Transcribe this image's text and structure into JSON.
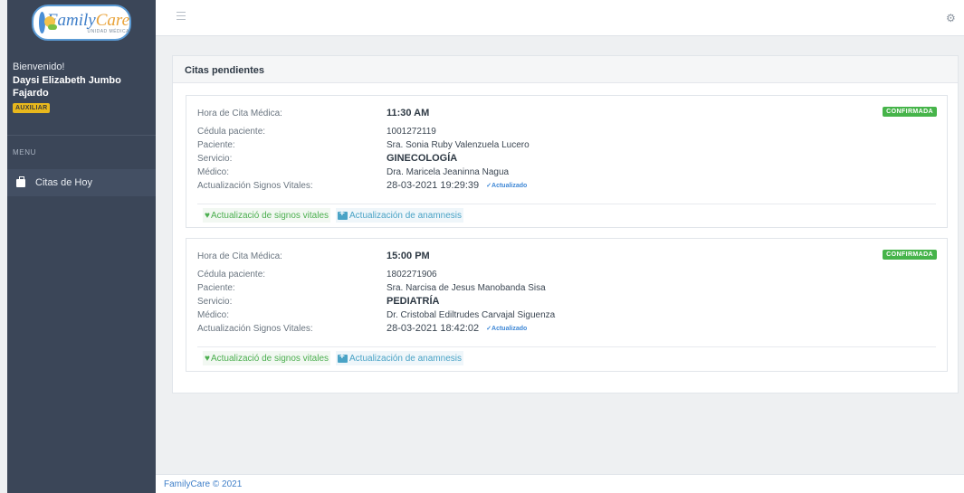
{
  "app": {
    "logo_word_1": "Family",
    "logo_word_2": "Care",
    "logo_sub": "UNIDAD MÉDICA"
  },
  "sidebar": {
    "welcome": "Bienvenido!",
    "user_name": "Daysi Elizabeth Jumbo Fajardo",
    "role": "AUXILIAR",
    "menu_title": "MENU",
    "items": [
      {
        "label": "Citas de Hoy",
        "icon": "briefcase-icon"
      }
    ]
  },
  "main": {
    "card_title": "Citas pendientes",
    "labels": {
      "hora": "Hora de Cita Médica:",
      "cedula": "Cédula paciente:",
      "paciente": "Paciente:",
      "servicio": "Servicio:",
      "medico": "Médico:",
      "signos": "Actualización Signos Vitales:"
    },
    "updated_label": "✓Actualizado",
    "actions": {
      "vitals": "Actualizació de signos vitales",
      "anamnesis": "Actualización de anamnesis"
    },
    "appointments": [
      {
        "hora": "11:30 AM",
        "status": "CONFIRMADA",
        "cedula": "1001272119",
        "paciente": "Sra. Sonia Ruby Valenzuela Lucero",
        "servicio": "GINECOLOGÍA",
        "medico": "Dra. Maricela Jeaninna Nagua",
        "signos_fecha": "28-03-2021 19:29:39"
      },
      {
        "hora": "15:00 PM",
        "status": "CONFIRMADA",
        "cedula": "1802271906",
        "paciente": "Sra. Narcisa de Jesus Manobanda Sisa",
        "servicio": "PEDIATRÍA",
        "medico": "Dr. Cristobal Ediltrudes Carvajal Siguenza",
        "signos_fecha": "28-03-2021 18:42:02"
      }
    ]
  },
  "footer": {
    "text": "FamilyCare © 2021"
  },
  "colors": {
    "sidebar_bg": "#3b4658",
    "status_green": "#46b44a",
    "role_yellow": "#e8b81d",
    "link_blue": "#3f7fc9"
  }
}
